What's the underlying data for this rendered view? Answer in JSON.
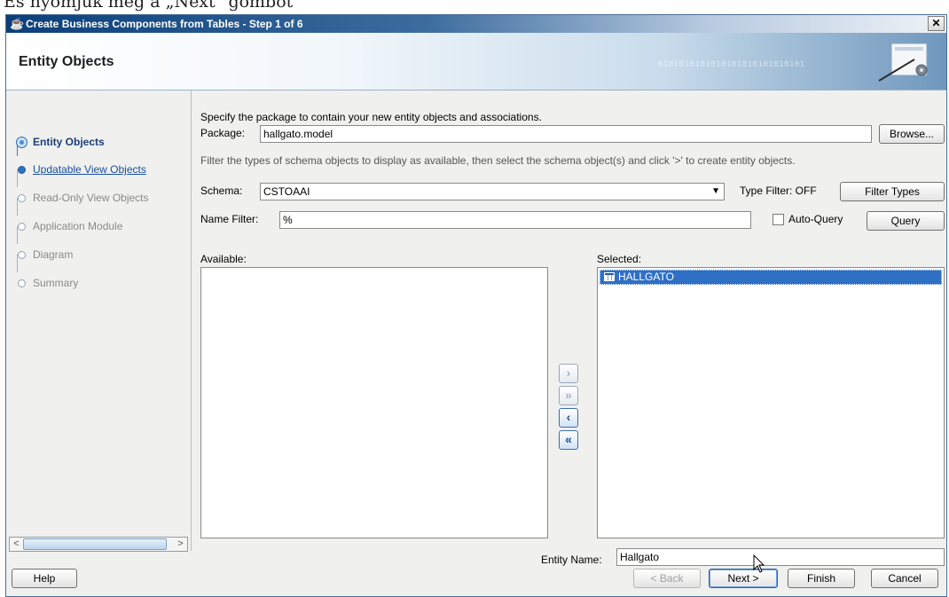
{
  "document": {
    "caption": "Es nyomjuk meg a „Next\" gombot"
  },
  "window": {
    "title": "Create Business Components from Tables - Step 1 of 6",
    "close_glyph": "✕"
  },
  "banner": {
    "title": "Entity Objects",
    "binary_text": "0101010101010101010101010101"
  },
  "nav": {
    "items": [
      {
        "label": "Entity Objects",
        "state": "active"
      },
      {
        "label": "Updatable View Objects",
        "state": "link"
      },
      {
        "label": "Read-Only View Objects",
        "state": "disabled"
      },
      {
        "label": "Application Module",
        "state": "disabled"
      },
      {
        "label": "Diagram",
        "state": "disabled"
      },
      {
        "label": "Summary",
        "state": "disabled"
      }
    ],
    "scroll_left": "<",
    "scroll_right": ">"
  },
  "content": {
    "instruction": "Specify the package to contain your new entity objects and associations.",
    "package_label": "Package:",
    "package_value": "hallgato.model",
    "browse_label": "Browse...",
    "filter_hint": "Filter the types of schema objects to display as available, then select the schema object(s) and click '>' to create entity objects.",
    "schema_label": "Schema:",
    "schema_value": "CSTOAAI",
    "type_filter_status": "Type Filter: OFF",
    "filter_types_label": "Filter Types",
    "name_filter_label": "Name Filter:",
    "name_filter_value": "%",
    "auto_query_label": "Auto-Query",
    "auto_query_checked": false,
    "query_label": "Query",
    "available_label": "Available:",
    "available_items": [],
    "selected_label": "Selected:",
    "selected_items": [
      "HALLGATO"
    ],
    "shuttle": {
      "add": "›",
      "add_all": "»",
      "remove": "‹",
      "remove_all": "«"
    },
    "entity_name_label": "Entity Name:",
    "entity_name_value": "Hallgato"
  },
  "footer": {
    "help": "Help",
    "back": "< Back",
    "next": "Next >",
    "finish": "Finish",
    "cancel": "Cancel"
  },
  "colors": {
    "accent": "#2f6fc4",
    "nav_active": "#1a3f7a",
    "titlebar": "#0a3f7a"
  }
}
